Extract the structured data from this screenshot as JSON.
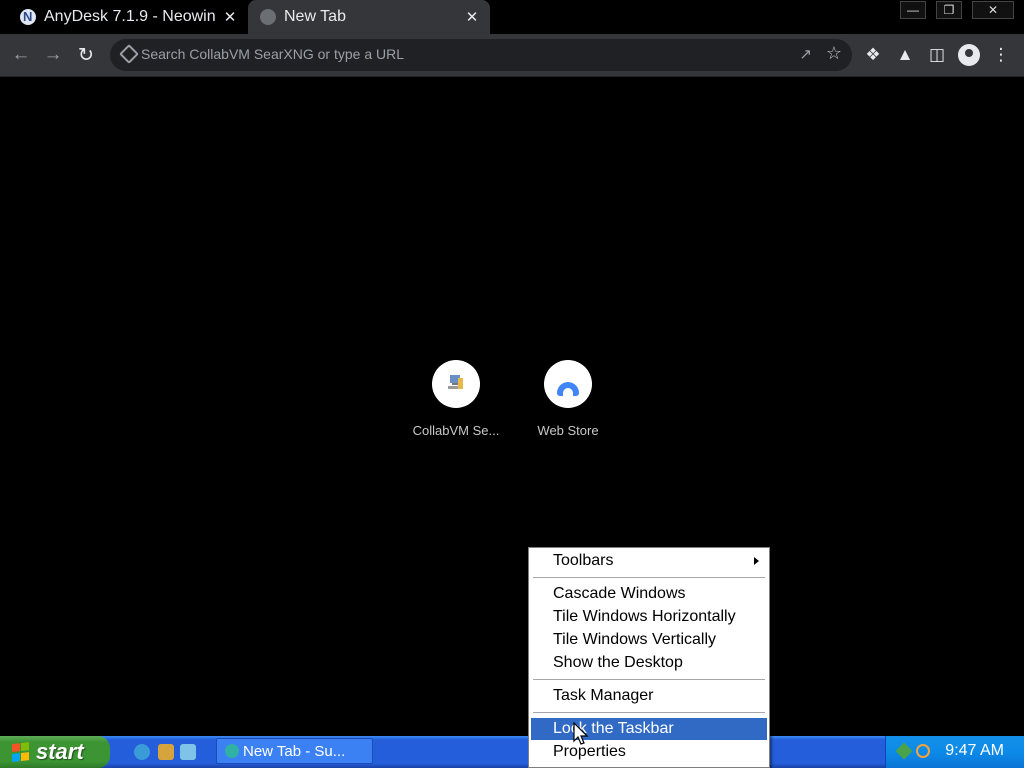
{
  "browser": {
    "tabs": [
      {
        "title": "AnyDesk 7.1.9 - Neowin",
        "icon": "neowin-favicon",
        "active": false
      },
      {
        "title": "New Tab",
        "icon": "globe-favicon",
        "active": true
      }
    ],
    "tab_close_glyph": "✕",
    "window_controls": {
      "minimize": "—",
      "restore": "❐",
      "close": "✕"
    },
    "omnibox": {
      "placeholder": "Search CollabVM SearXNG or type a URL"
    },
    "toolbar_icons": [
      "back-icon",
      "forward-icon",
      "reload-icon",
      "share-icon",
      "bookmark-star-icon",
      "extensions-icon",
      "labs-icon",
      "side-panel-icon",
      "profile-icon",
      "menu-icon"
    ]
  },
  "shortcuts": [
    {
      "label": "CollabVM Se...",
      "icon": "collabvm-icon"
    },
    {
      "label": "Web Store",
      "icon": "webstore-icon"
    }
  ],
  "context_menu": {
    "items": [
      {
        "label": "Toolbars",
        "submenu": true
      },
      {
        "label": "Cascade Windows"
      },
      {
        "label": "Tile Windows Horizontally"
      },
      {
        "label": "Tile Windows Vertically"
      },
      {
        "label": "Show the Desktop"
      },
      {
        "label": "Task Manager"
      },
      {
        "label": "Lock the Taskbar",
        "highlighted": true
      },
      {
        "label": "Properties"
      }
    ]
  },
  "taskbar": {
    "start_label": "start",
    "quick_launch": [
      "internet-explorer-icon",
      "media-icon",
      "browser-icon"
    ],
    "task_button": "New Tab - Su...",
    "clock": "9:47 AM"
  },
  "colors": {
    "xp_blue": "#245edb",
    "start_green": "#3c9433",
    "menu_highlight": "#316ac5",
    "chrome_toolbar": "#35363a"
  }
}
